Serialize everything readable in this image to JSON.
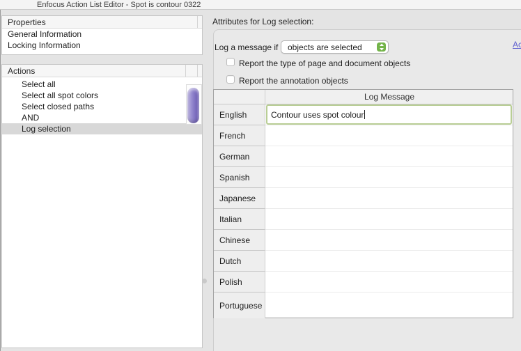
{
  "window": {
    "title": "Enfocus Action List Editor - Spot is contour 0322"
  },
  "properties_panel": {
    "header": "Properties",
    "items": [
      "General Information",
      "Locking Information"
    ]
  },
  "actions_panel": {
    "header": "Actions",
    "items": [
      "Select all",
      "Select all spot colors",
      "Select closed paths",
      "AND",
      "Log selection"
    ],
    "selected_item": "Log selection"
  },
  "attributes_pane": {
    "title": "Attributes for Log selection:",
    "condition_label": "Log a message if",
    "condition_value": "objects are selected",
    "checkboxes": [
      {
        "label": "Report the type of page and document objects",
        "checked": false
      },
      {
        "label": "Report the annotation objects",
        "checked": false
      }
    ],
    "link_text": "Ac",
    "table": {
      "header": "Log Message",
      "rows": [
        {
          "language": "English",
          "message": "Contour uses spot colour"
        },
        {
          "language": "French",
          "message": ""
        },
        {
          "language": "German",
          "message": ""
        },
        {
          "language": "Spanish",
          "message": ""
        },
        {
          "language": "Japanese",
          "message": ""
        },
        {
          "language": "Italian",
          "message": ""
        },
        {
          "language": "Chinese",
          "message": ""
        },
        {
          "language": "Dutch",
          "message": ""
        },
        {
          "language": "Polish",
          "message": ""
        },
        {
          "language": "Portuguese",
          "message": ""
        }
      ]
    }
  },
  "colors": {
    "popup_stepper_green": "#74b44a",
    "focused_cell_border_green": "#b9ce95",
    "scrollbar_thumb_purple": "#8d80ca",
    "link_blue": "#6262d0",
    "selected_row_gray": "#d8d8d8"
  }
}
